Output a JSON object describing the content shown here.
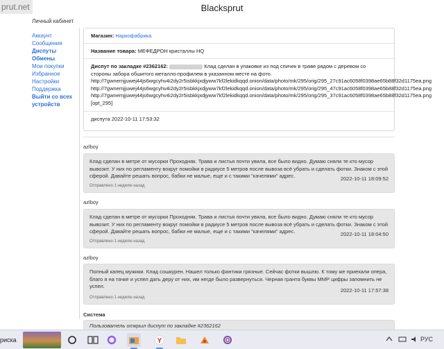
{
  "header": {
    "logo_text": "prut.net",
    "site_title": "Blacksprut"
  },
  "sidebar": {
    "cabinet": "Личный кабинет",
    "items": [
      {
        "label": "Аккаунт",
        "bold": false
      },
      {
        "label": "Сообщения",
        "bold": false
      },
      {
        "label": "Диспуты",
        "bold": true
      },
      {
        "label": "Обмены",
        "bold": true
      },
      {
        "label": "Мои покупки",
        "bold": false
      },
      {
        "label": "Избранное",
        "bold": false
      },
      {
        "label": "Настройки",
        "bold": false
      },
      {
        "label": "Поддержка",
        "bold": false
      },
      {
        "label": "Выйти со всех устройств",
        "bold": true
      }
    ]
  },
  "order": {
    "shop_label": "Магазин:",
    "shop_value": "Наркофабрика",
    "product_label": "Название товара:",
    "product_value": "МЕФЕДРОН кристаллы HQ",
    "dispute_label": "Диспут по закладке #2362162:",
    "dispute_text": "Клад сделан в упаковке из под спичек в траве рядом с деревом со стороны забора обшитого металло-профилем в указанном месте на фото.",
    "photo_links": [
      "http://7gwnemjjuwej44js6wgcyhv4i2dy2r5isbkkjxdjyww7kf2lekidkqqd.onion/data/photo/mk/295/orig/295_27c91ac6058f0398ae65b88f32d1175ea.png",
      "http://7gwnemjjuwej44js6wgcyhv4i2dy2r5isbkkjxdjyww7kf2lekidkqqd.onion/data/photo/mk/295/orig/295_47c91ac6058f0398ae65b88f32d1175ea.png",
      "http://7gwnemjjuwej44js6wgcyhv4i2dy2r5isbkkjxdjyww7kf2lekidkqqd.onion/data/photo/mk/295/orig/295_37c91ac6058f0398ae65b88f32d1175ea.png",
      "[opt_295]"
    ],
    "dispute_date_line": "диспута 2022-10-11 17:53:32"
  },
  "messages": [
    {
      "author": "azlboy",
      "text": "Клад сделан в метре от мусорки Проходняк. Трава и листья почти увяла, все было видно. Думаю сняли те кто мусор вывозит. У них по регламенту вокруг помойки в радиусе 5 метров после вывоза всё убрать и сделать фотки. Знаком с этой сферой. Давайте решать вопрос, бабки не малые, еще и с такими \"качелями\" адрес.",
      "date": "2022-10-11 18:09:52",
      "sent": "Отправлено 1 неделю назад"
    },
    {
      "author": "azlboy",
      "text": "Клад сделан в метре от мусорки Проходняк. Трава и листья почти увяла, все было видно. Думаю сняли те кто мусор вывозит. У них по регламенту вокруг помойки в радиусе 5 метров после вывоза всё убрать и сделать фотки. Знаком с этой сферой. Давайте решать вопрос, бабки не малые, еще и с такими \"качелями\" адрес.",
      "date": "2022-10-11 18:04:50",
      "sent": "Отправлено 1 неделю назад"
    },
    {
      "author": "azlboy",
      "text": "Полный капец мужики. Клад сошкурен. Нашел только фантики грязные. Сейчас фотки вышлю. К тому же приехали опера, благо я на тачке и успел дать деру от них, им негде было развернуться. Черная гранта буквы МMР цифры запомнить не успел.",
      "date": "2022-10-11 17:57:38",
      "sent": "Отправлено 1 неделю назад"
    }
  ],
  "system_message": {
    "author": "Система",
    "text": "Пользователь открыл диспут по закладке #2362162"
  },
  "taskbar": {
    "search_fragment": "риска",
    "tray_lang": "РУС"
  }
}
